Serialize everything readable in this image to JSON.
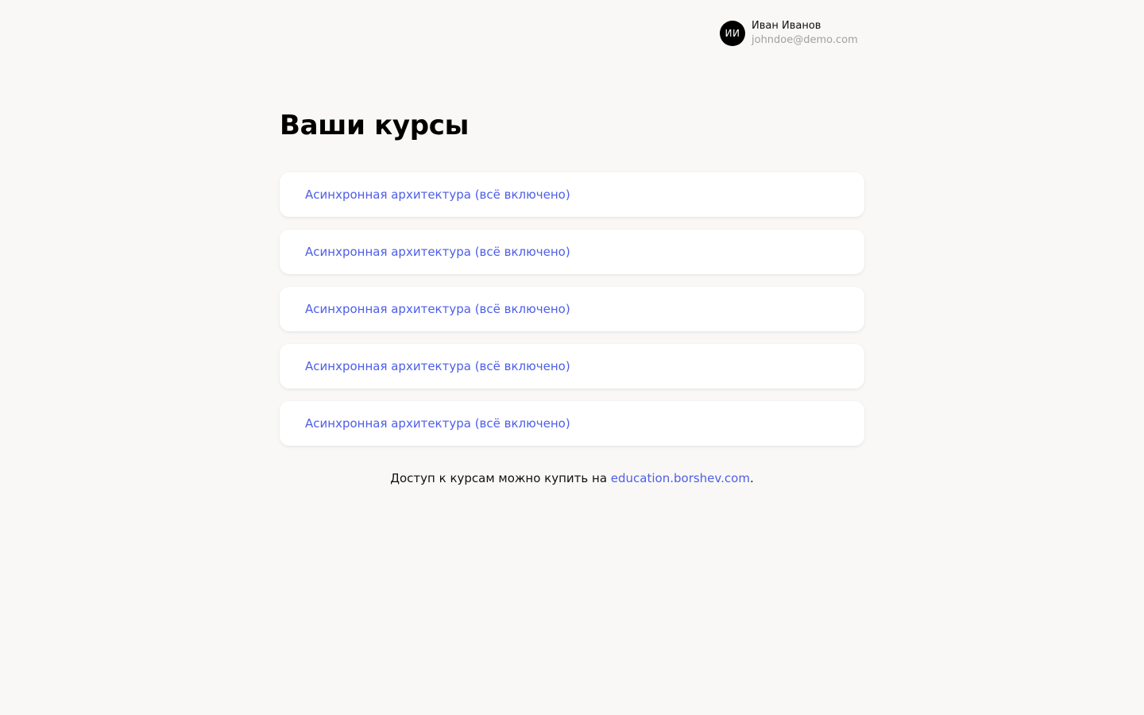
{
  "user": {
    "initials": "ИИ",
    "name": "Иван Иванов",
    "email": "johndoe@demo.com"
  },
  "page": {
    "title": "Ваши курсы"
  },
  "courses": [
    {
      "title": "Асинхронная архитектура (всё включено)"
    },
    {
      "title": "Асинхронная архитектура (всё включено)"
    },
    {
      "title": "Асинхронная архитектура (всё включено)"
    },
    {
      "title": "Асинхронная архитектура (всё включено)"
    },
    {
      "title": "Асинхронная архитектура (всё включено)"
    }
  ],
  "footer": {
    "text_before": "Доступ к курсам можно купить на ",
    "link_text": "education.borshev.com",
    "text_after": "."
  },
  "colors": {
    "background": "#f9f8f6",
    "accent": "#4d5ee8",
    "card": "#ffffff",
    "avatar": "#000000"
  }
}
